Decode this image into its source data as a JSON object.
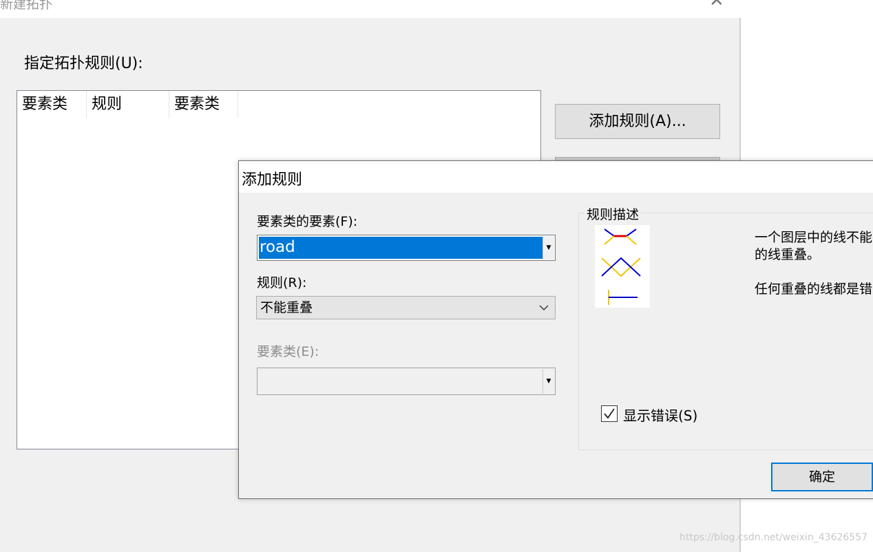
{
  "background_window": {
    "title": "新建拓扑",
    "close_glyph": "✕",
    "specify_rules_label": "指定拓扑规则(U):",
    "columns": [
      "要素类",
      "规则",
      "要素类"
    ],
    "add_rule_button": "添加规则(A)..."
  },
  "dialog": {
    "title": "添加规则",
    "feature_class_features_label": "要素类的要素(F):",
    "feature_class_features_value": "road",
    "rule_label": "规则(R):",
    "rule_value": "不能重叠",
    "feature_class_label": "要素类(E):",
    "feature_class_value": "",
    "rule_description_title": "规则描述",
    "description_lines": [
      "一个图层中的线不能",
      "的线重叠。",
      "任何重叠的线都是错"
    ],
    "show_errors_label": "显示错误(S)",
    "show_errors_checked": true,
    "ok_button": "确定"
  },
  "rule_image_colors": {
    "error": "#e00000",
    "line_a": "#f5c400",
    "line_b": "#0000cc"
  },
  "watermark": "https://blog.csdn.net/weixin_43626557"
}
